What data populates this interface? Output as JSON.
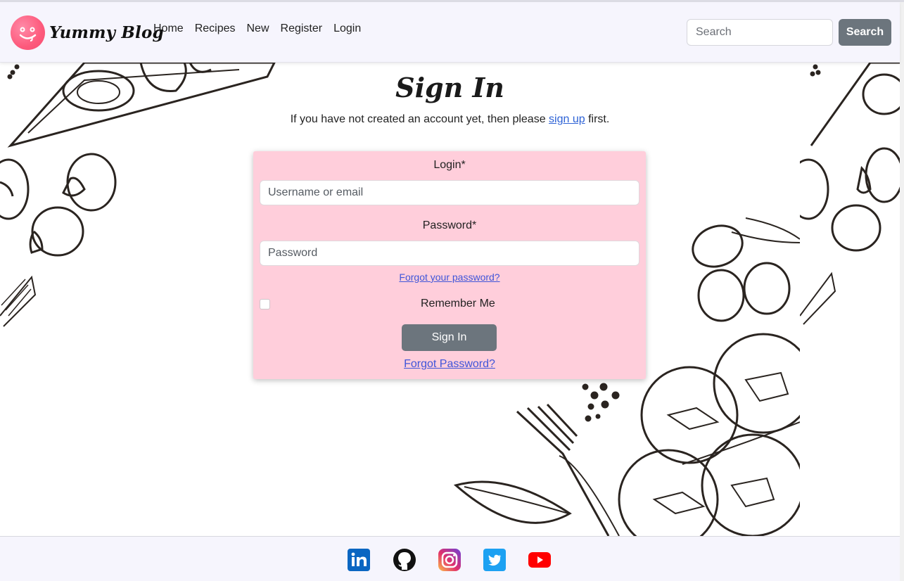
{
  "navbar": {
    "brand": "Yummy Blog",
    "links": [
      "Home",
      "Recipes",
      "New",
      "Register",
      "Login"
    ],
    "search_placeholder": "Search",
    "search_button": "Search"
  },
  "main": {
    "title": "Sign In",
    "subtitle_before": "If you have not created an account yet, then please ",
    "subtitle_link": "sign up",
    "subtitle_after": " first."
  },
  "form": {
    "login_label": "Login*",
    "login_placeholder": "Username or email",
    "password_label": "Password*",
    "password_placeholder": "Password",
    "forgot_small": "Forgot your password?",
    "remember_label": "Remember Me",
    "remember_checked": false,
    "submit_label": "Sign In",
    "forgot_bottom": "Forgot Password?"
  },
  "footer": {
    "social_icons": [
      "linkedin-icon",
      "github-icon",
      "instagram-icon",
      "twitter-icon",
      "youtube-icon"
    ],
    "colors": {
      "linkedin": "#0a66c2",
      "instagram": "#d6249f",
      "twitter": "#1da1f2",
      "youtube": "#ff0000"
    }
  },
  "colors": {
    "card_bg": "#ffcedb",
    "button_gray": "#6c757d",
    "link_blue": "#3f55d9",
    "navbar_bg": "#f6f5fd"
  }
}
